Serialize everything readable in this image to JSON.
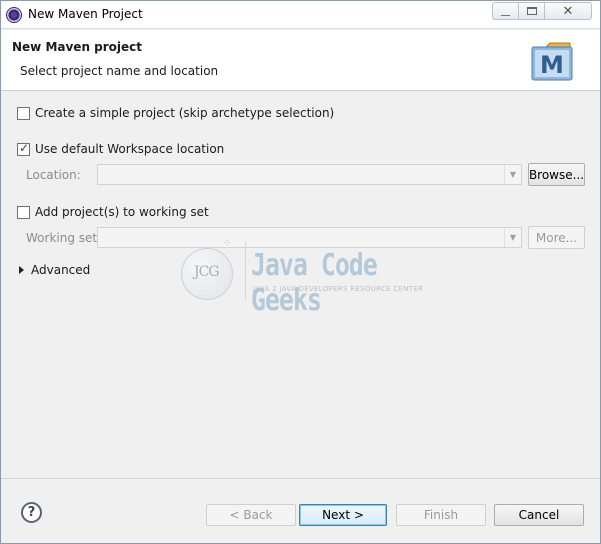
{
  "window": {
    "title": "New Maven Project",
    "controls": {
      "minimize": "minimize",
      "maximize": "maximize",
      "close": "✕"
    }
  },
  "header": {
    "title": "New Maven project",
    "subtitle": "Select project name and location",
    "logo_letter": "M"
  },
  "form": {
    "simple_project": {
      "label": "Create a simple project (skip archetype selection)",
      "checked": false
    },
    "default_workspace": {
      "label": "Use default Workspace location",
      "checked": true
    },
    "location": {
      "label": "Location:",
      "value": "",
      "browse_label": "Browse..."
    },
    "working_set_toggle": {
      "label": "Add project(s) to working set",
      "checked": false
    },
    "working_set": {
      "label": "Working set:",
      "value": "",
      "more_label": "More..."
    },
    "advanced_label": "Advanced"
  },
  "watermark": {
    "logo": "JCG",
    "title": "Java Code Geeks",
    "tagline": "JAVA 2 JAVA DEVELOPERS RESOURCE CENTER"
  },
  "footer": {
    "back": "< Back",
    "next": "Next >",
    "finish": "Finish",
    "cancel": "Cancel",
    "help": "?"
  }
}
